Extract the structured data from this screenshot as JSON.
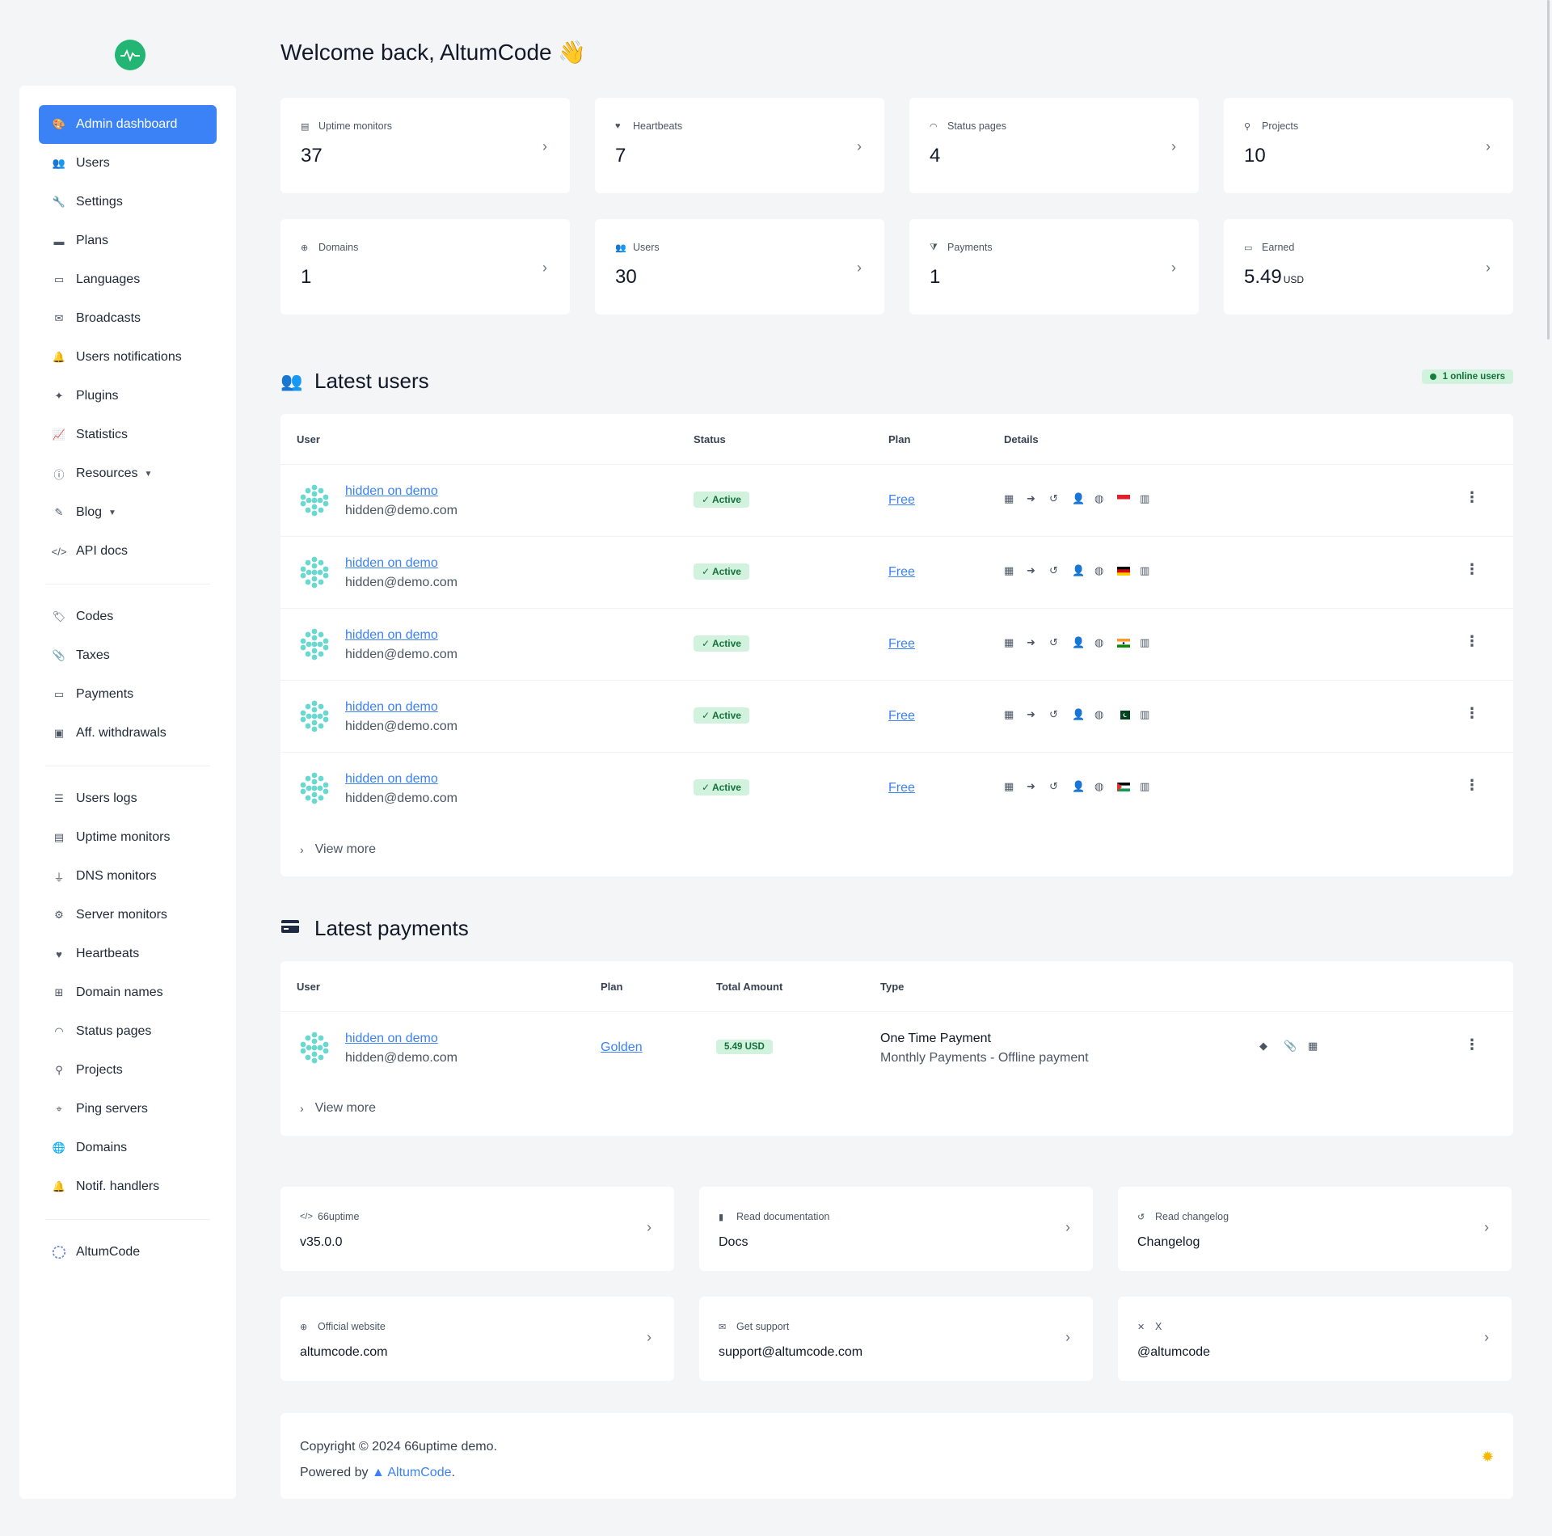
{
  "sidebar": {
    "group1": [
      {
        "label": "Admin dashboard",
        "icon": "palette-icon",
        "glyph": "🎨",
        "active": true
      },
      {
        "label": "Users",
        "icon": "users-icon",
        "glyph": "👥"
      },
      {
        "label": "Settings",
        "icon": "wrench-icon",
        "glyph": "🔧"
      },
      {
        "label": "Plans",
        "icon": "box-icon",
        "glyph": "▬"
      },
      {
        "label": "Languages",
        "icon": "language-icon",
        "glyph": "▭"
      },
      {
        "label": "Broadcasts",
        "icon": "mail-bulk-icon",
        "glyph": "✉"
      },
      {
        "label": "Users notifications",
        "icon": "bell-icon",
        "glyph": "🔔"
      },
      {
        "label": "Plugins",
        "icon": "puzzle-icon",
        "glyph": "✦"
      },
      {
        "label": "Statistics",
        "icon": "chart-icon",
        "glyph": "📈"
      },
      {
        "label": "Resources",
        "icon": "info-circle-icon",
        "glyph": "ⓘ",
        "caret": true
      },
      {
        "label": "Blog",
        "icon": "blog-icon",
        "glyph": "✎",
        "caret": true
      },
      {
        "label": "API docs",
        "icon": "code-icon",
        "glyph": "</>"
      }
    ],
    "group2": [
      {
        "label": "Codes",
        "icon": "tags-icon",
        "glyph": "🏷"
      },
      {
        "label": "Taxes",
        "icon": "paperclip-icon",
        "glyph": "📎"
      },
      {
        "label": "Payments",
        "icon": "credit-card-icon",
        "glyph": "▭"
      },
      {
        "label": "Aff. withdrawals",
        "icon": "wallet-icon",
        "glyph": "▣"
      }
    ],
    "group3": [
      {
        "label": "Users logs",
        "icon": "list-icon",
        "glyph": "☰"
      },
      {
        "label": "Uptime monitors",
        "icon": "server-icon",
        "glyph": "▤"
      },
      {
        "label": "DNS monitors",
        "icon": "plug-icon",
        "glyph": "⏚"
      },
      {
        "label": "Server monitors",
        "icon": "microchip-icon",
        "glyph": "⚙"
      },
      {
        "label": "Heartbeats",
        "icon": "heart-pulse-icon",
        "glyph": "♥"
      },
      {
        "label": "Domain names",
        "icon": "network-icon",
        "glyph": "⊞"
      },
      {
        "label": "Status pages",
        "icon": "wifi-icon",
        "glyph": "◠"
      },
      {
        "label": "Projects",
        "icon": "project-icon",
        "glyph": "⚲"
      },
      {
        "label": "Ping servers",
        "icon": "map-marker-icon",
        "glyph": "⌖"
      },
      {
        "label": "Domains",
        "icon": "globe-icon",
        "glyph": "🌐"
      },
      {
        "label": "Notif. handlers",
        "icon": "bell-icon",
        "glyph": "🔔"
      }
    ],
    "account": {
      "label": "AltumCode"
    }
  },
  "welcome": "Welcome back, AltumCode 👋",
  "stats": [
    {
      "label": "Uptime monitors",
      "value": "37",
      "icon": "server-icon",
      "glyph": "▤"
    },
    {
      "label": "Heartbeats",
      "value": "7",
      "icon": "heart-pulse-icon",
      "glyph": "♥"
    },
    {
      "label": "Status pages",
      "value": "4",
      "icon": "wifi-icon",
      "glyph": "◠"
    },
    {
      "label": "Projects",
      "value": "10",
      "icon": "project-icon",
      "glyph": "⚲"
    },
    {
      "label": "Domains",
      "value": "1",
      "icon": "globe-icon",
      "glyph": "⊕"
    },
    {
      "label": "Users",
      "value": "30",
      "icon": "users-icon",
      "glyph": "👥"
    },
    {
      "label": "Payments",
      "value": "1",
      "icon": "funnel-dollar-icon",
      "glyph": "⧩"
    },
    {
      "label": "Earned",
      "value": "5.49",
      "unit": "USD",
      "icon": "credit-card-icon",
      "glyph": "▭"
    }
  ],
  "latest_users": {
    "title": "Latest users",
    "online_badge": "1 online users",
    "headers": {
      "user": "User",
      "status": "Status",
      "plan": "Plan",
      "details": "Details"
    },
    "rows": [
      {
        "name": "hidden on demo",
        "email": "hidden@demo.com",
        "status": "✓  Active",
        "plan": "Free",
        "flag": "indonesia"
      },
      {
        "name": "hidden on demo",
        "email": "hidden@demo.com",
        "status": "✓  Active",
        "plan": "Free",
        "flag": "germany"
      },
      {
        "name": "hidden on demo",
        "email": "hidden@demo.com",
        "status": "✓  Active",
        "plan": "Free",
        "flag": "india"
      },
      {
        "name": "hidden on demo",
        "email": "hidden@demo.com",
        "status": "✓  Active",
        "plan": "Free",
        "flag": "pakistan"
      },
      {
        "name": "hidden on demo",
        "email": "hidden@demo.com",
        "status": "✓  Active",
        "plan": "Free",
        "flag": "palestine"
      }
    ],
    "view_more": "View more"
  },
  "latest_payments": {
    "title": "Latest payments",
    "headers": {
      "user": "User",
      "plan": "Plan",
      "total": "Total Amount",
      "type": "Type"
    },
    "rows": [
      {
        "name": "hidden on demo",
        "email": "hidden@demo.com",
        "plan": "Golden",
        "amount": "5.49 USD",
        "type": "One Time Payment",
        "subtype": "Monthly Payments - Offline payment"
      }
    ],
    "view_more": "View more"
  },
  "info_cards": [
    {
      "label": "66uptime",
      "value": "v35.0.0",
      "icon": "code-icon",
      "glyph": "</>"
    },
    {
      "label": "Read documentation",
      "value": "Docs",
      "icon": "book-icon",
      "glyph": "▮"
    },
    {
      "label": "Read changelog",
      "value": "Changelog",
      "icon": "history-icon",
      "glyph": "↺"
    },
    {
      "label": "Official website",
      "value": "altumcode.com",
      "icon": "globe-icon",
      "glyph": "⊕"
    },
    {
      "label": "Get support",
      "value": "support@altumcode.com",
      "icon": "envelope-icon",
      "glyph": "✉"
    },
    {
      "label": "X",
      "value": "@altumcode",
      "icon": "x-icon",
      "glyph": "✕"
    }
  ],
  "footer": {
    "copyright": "Copyright © 2024 66uptime demo.",
    "powered_prefix": "Powered by ",
    "powered_link": "AltumCode",
    "powered_suffix": "."
  },
  "colors": {
    "accent": "#3b82f6",
    "success_bg": "#d1f2dc",
    "success_text": "#15703d",
    "logo": "#22b573"
  }
}
